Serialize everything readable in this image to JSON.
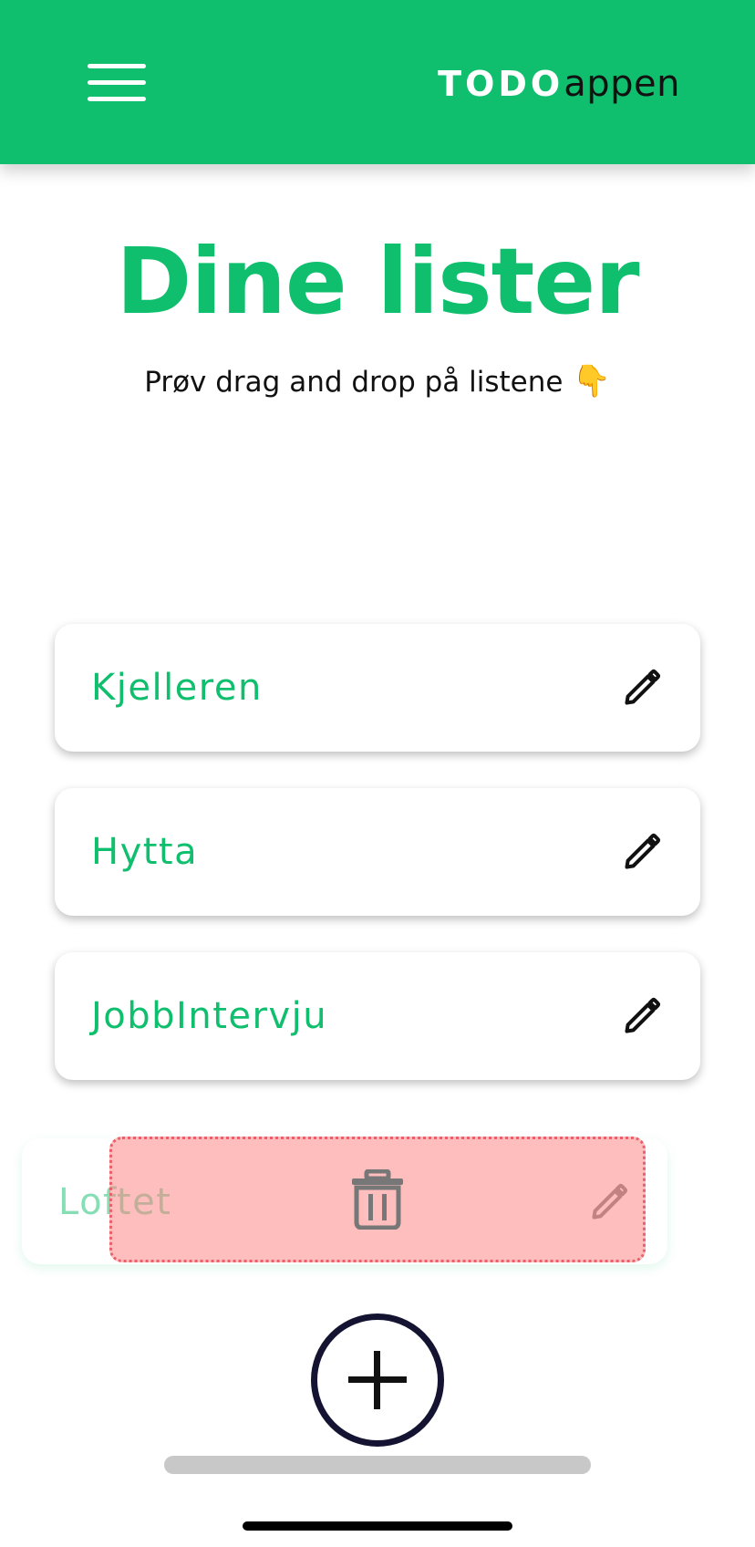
{
  "header": {
    "menu_icon": "hamburger-menu-icon",
    "brand_bold": "TODO",
    "brand_light": "appen",
    "bg_color": "#0fbf6e"
  },
  "main": {
    "title": "Dine lister",
    "subtitle": "Prøv drag and drop på listene",
    "subtitle_emoji": "👇"
  },
  "lists": [
    {
      "label": "Kjelleren",
      "icon": "pencil-icon"
    },
    {
      "label": "Hytta",
      "icon": "pencil-icon"
    },
    {
      "label": "JobbIntervju",
      "icon": "pencil-icon"
    }
  ],
  "dragging_item": {
    "label": "Loftet",
    "icon": "pencil-icon"
  },
  "delete_zone": {
    "icon": "trash-icon",
    "color": "#ff7d7d"
  },
  "add_button": {
    "icon": "plus-icon"
  },
  "colors": {
    "accent": "#0fbf6e",
    "text": "#111111"
  }
}
